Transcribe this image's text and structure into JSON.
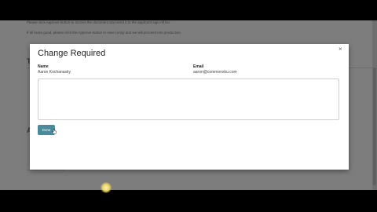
{
  "background": {
    "line1": "Please click Approve button to access the document and send it to the applicant sign-off list.",
    "line2": "If all looks good, please click the Approve button to save (only) and we will proceed into production.",
    "heading_t": "T",
    "heading_a": "A"
  },
  "modal": {
    "title": "Change Required",
    "close_glyph": "×",
    "name_label": "Name",
    "name_value": "Aaron Kochanasky",
    "email_label": "Email",
    "email_value": "aaron@commonsku.com",
    "notes_value": "",
    "done_label": "Done"
  },
  "colors": {
    "overlay": "#7d7d7d",
    "done_button": "#4a8a9a"
  },
  "icons": {
    "close": "close-icon",
    "cursor": "hand-pointer-icon"
  }
}
